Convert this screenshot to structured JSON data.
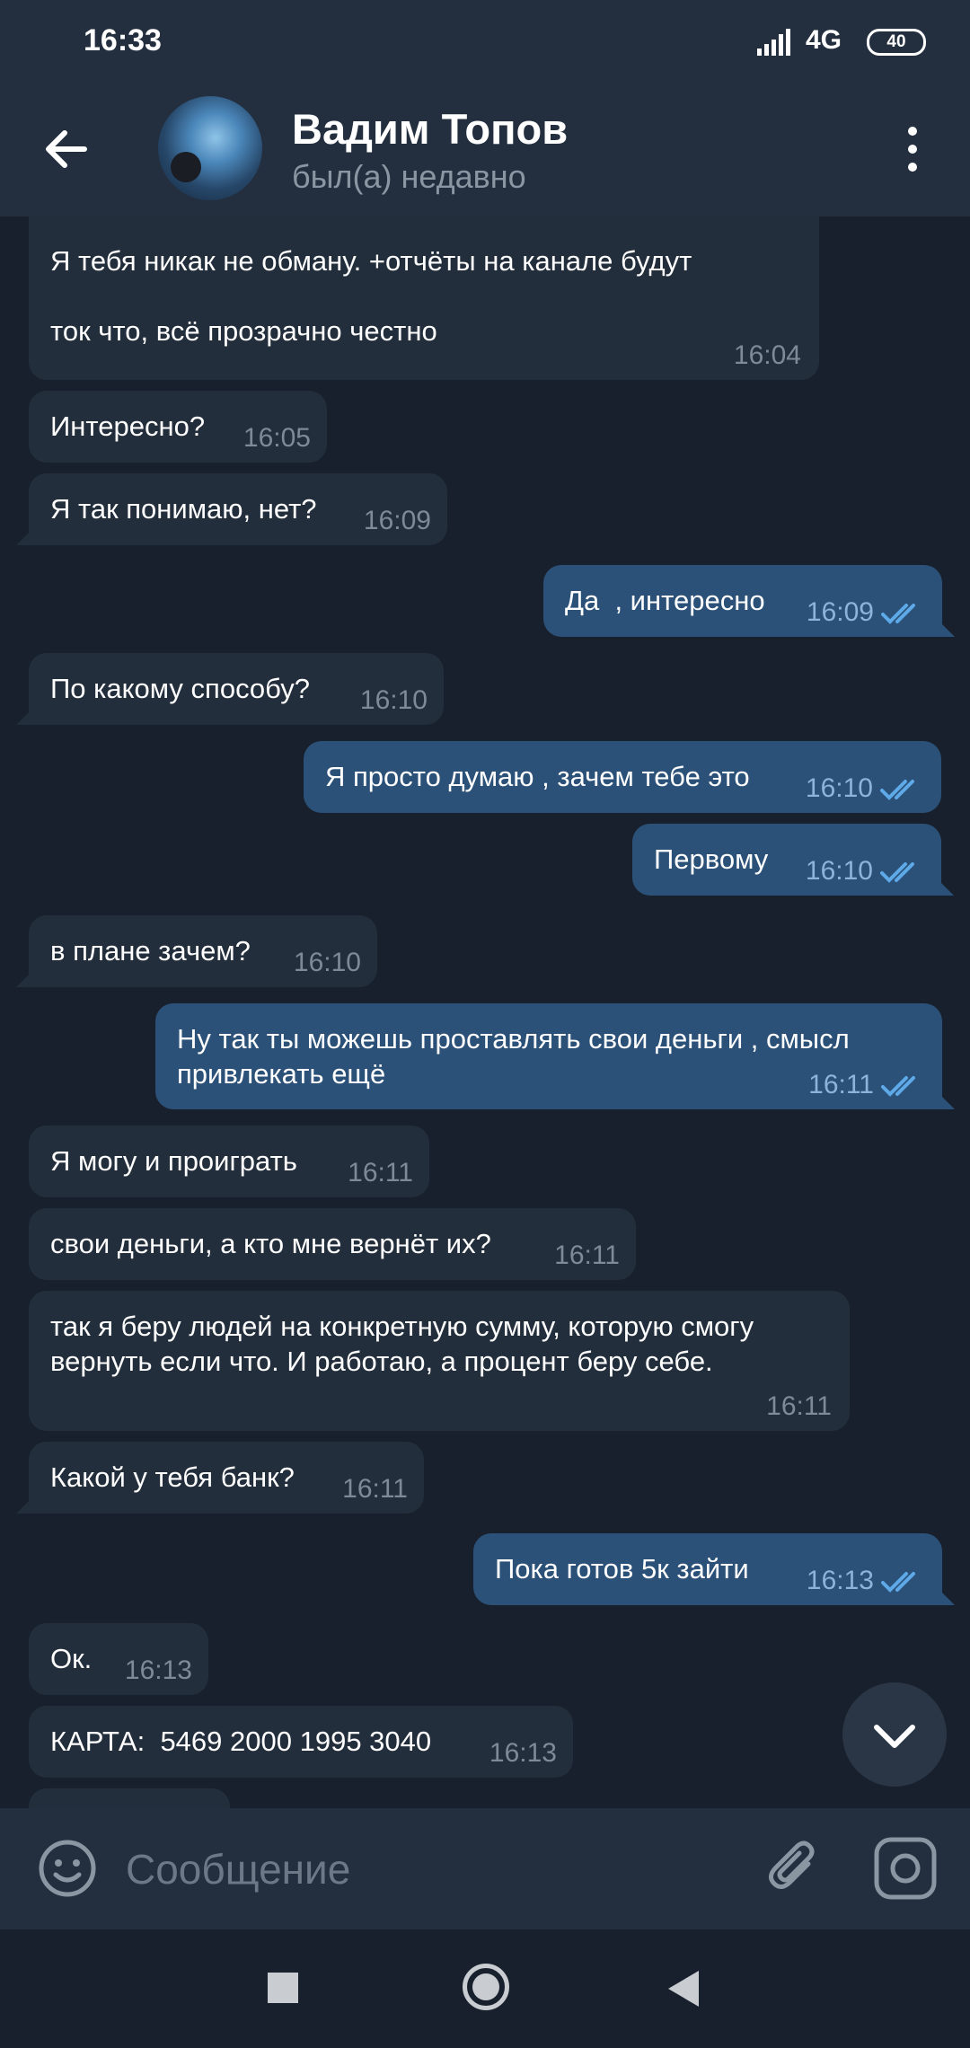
{
  "status_bar": {
    "time": "16:33",
    "network": "4G",
    "battery": "40"
  },
  "header": {
    "contact_name": "Вадим Топов",
    "contact_status": "был(а) недавно"
  },
  "messages": [
    {
      "direction": "in",
      "text": "Я тебя никак не обману. +отчёты на канале будут\n\nток что, всё прозрачно честно",
      "time": "16:04"
    },
    {
      "direction": "in",
      "text": "Интересно?",
      "time": "16:05"
    },
    {
      "direction": "in",
      "text": "Я так понимаю, нет?",
      "time": "16:09"
    },
    {
      "direction": "out",
      "text": "Да  , интересно",
      "time": "16:09",
      "read": true
    },
    {
      "direction": "in",
      "text": "По какому способу?",
      "time": "16:10"
    },
    {
      "direction": "out",
      "text": "Я просто думаю , зачем тебе это",
      "time": "16:10",
      "read": true
    },
    {
      "direction": "out",
      "text": "Первому",
      "time": "16:10",
      "read": true
    },
    {
      "direction": "in",
      "text": "в плане зачем?",
      "time": "16:10"
    },
    {
      "direction": "out",
      "text": "Ну так ты можешь проставлять свои деньги , смысл привлекать ещё",
      "time": "16:11",
      "read": true
    },
    {
      "direction": "in",
      "text": "Я могу и проиграть",
      "time": "16:11"
    },
    {
      "direction": "in",
      "text": "свои деньги, а кто мне вернёт их?",
      "time": "16:11"
    },
    {
      "direction": "in",
      "text": "так я беру людей на конкретную сумму, которую смогу вернуть если что. И работаю, а процент беру себе.",
      "time": "16:11"
    },
    {
      "direction": "in",
      "text": "Какой у тебя банк?",
      "time": "16:11"
    },
    {
      "direction": "out",
      "text": "Пока готов 5к зайти",
      "time": "16:13",
      "read": true
    },
    {
      "direction": "in",
      "text": "Ок.",
      "time": "16:13"
    },
    {
      "direction": "in",
      "text": "КАРТА:  5469 2000 1995 3040",
      "time": "16:13"
    }
  ],
  "composer": {
    "placeholder": "Сообщение"
  },
  "icons": {
    "back": "arrow-left-icon",
    "menu": "more-vertical-icon",
    "scroll_down": "chevron-down-icon",
    "emoji": "smiley-icon",
    "attach": "paperclip-icon",
    "camera": "instagram-camera-icon"
  },
  "colors": {
    "background": "#17202c",
    "header": "#232f3f",
    "incoming_bubble": "#232e3c",
    "outgoing_bubble": "#2b5178",
    "read_checks": "#5ea9e8",
    "muted_text": "#7e8a97"
  }
}
